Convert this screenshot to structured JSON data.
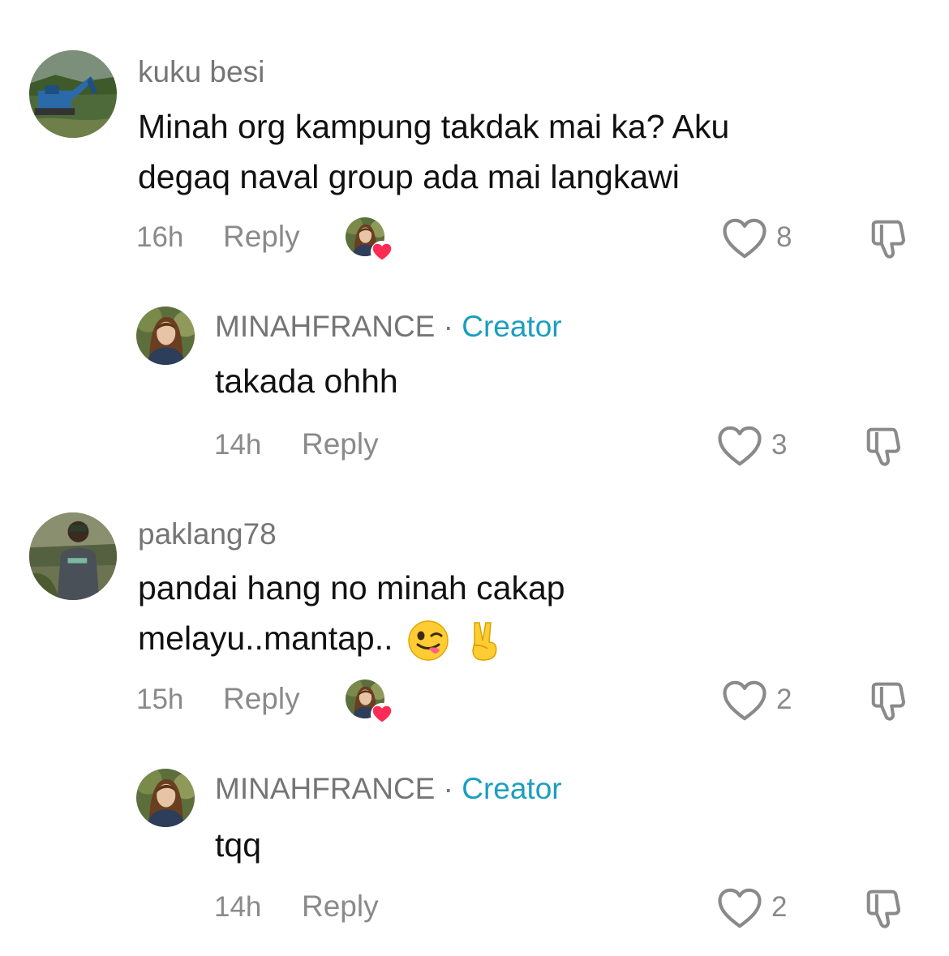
{
  "comments": [
    {
      "username": "kuku besi",
      "text_line1": "Minah org kampung takdak mai ka? Aku",
      "text_line2": "degaq naval group ada mai langkawi",
      "time": "16h",
      "reply_label": "Reply",
      "likes": "8",
      "liked_by_creator": true,
      "reply": {
        "username": "MINAHFRANCE",
        "separator": "·",
        "badge": "Creator",
        "text": "takada ohhh",
        "time": "14h",
        "reply_label": "Reply",
        "likes": "3"
      }
    },
    {
      "username": "paklang78",
      "text_line1": "pandai hang no minah cakap",
      "text_line2": "melayu..mantap..",
      "time": "15h",
      "reply_label": "Reply",
      "likes": "2",
      "liked_by_creator": true,
      "emojis": [
        "winking-tongue-emoji",
        "victory-hand-emoji"
      ],
      "reply": {
        "username": "MINAHFRANCE",
        "separator": "·",
        "badge": "Creator",
        "text": "tqq",
        "time": "14h",
        "reply_label": "Reply",
        "likes": "2"
      }
    }
  ],
  "colors": {
    "creator_badge": "#1b9ec0",
    "secondary_text": "#757575",
    "heart_red": "#fe2c55"
  }
}
